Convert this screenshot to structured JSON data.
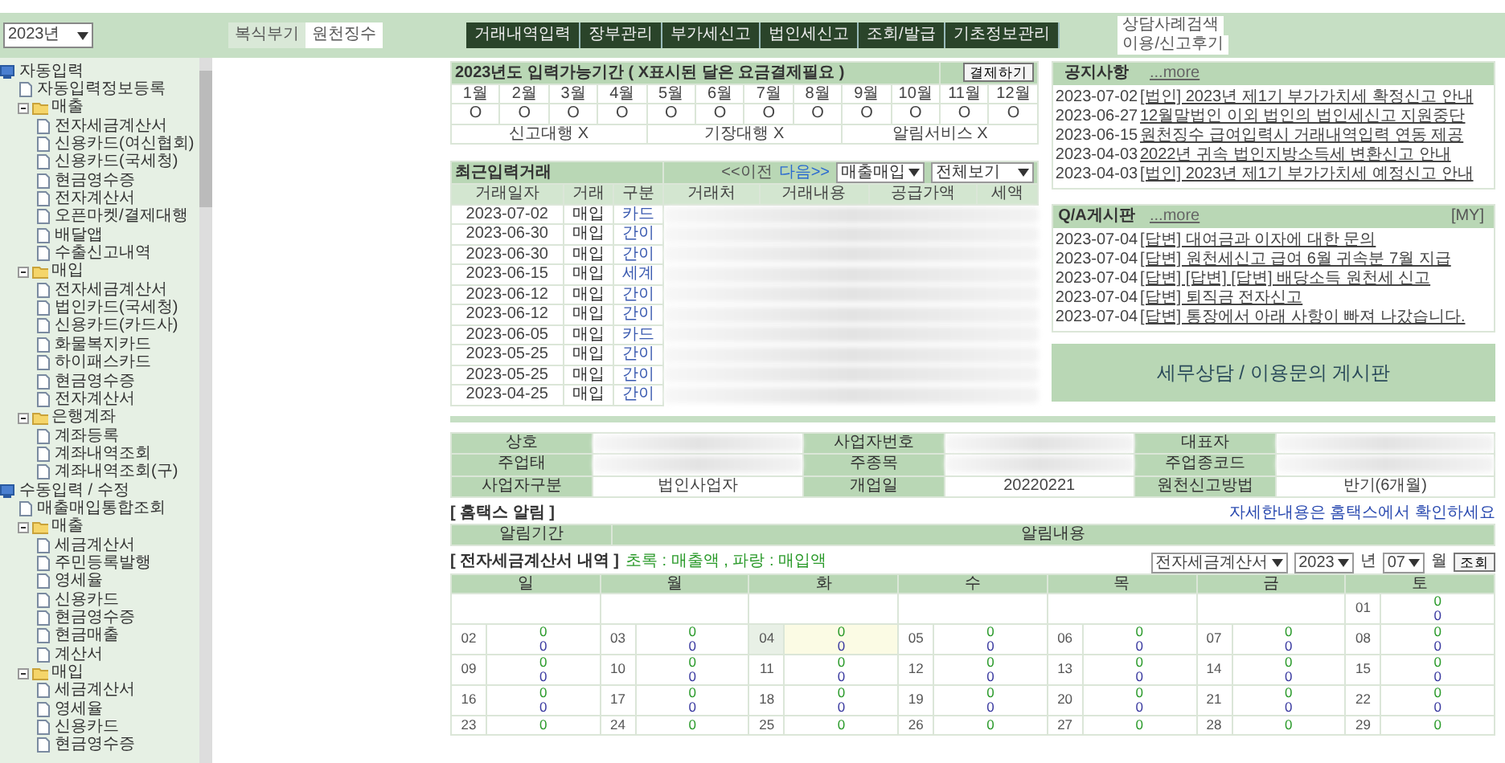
{
  "header": {
    "year_select": "2023년",
    "mode_buttons": [
      {
        "label": "복식부기",
        "selected": false
      },
      {
        "label": "원천징수",
        "selected": true
      }
    ],
    "menu": [
      "거래내역입력",
      "장부관리",
      "부가세신고",
      "법인세신고",
      "조회/발급",
      "기초정보관리"
    ],
    "side_links": [
      "상담사례검색",
      "이용/신고후기"
    ]
  },
  "sidebar": {
    "items": [
      {
        "label": "자동입력",
        "kind": "section",
        "children": [
          {
            "label": "자동입력정보등록",
            "kind": "page"
          },
          {
            "label": "매출",
            "kind": "folder",
            "children": [
              {
                "label": "전자세금계산서",
                "kind": "page"
              },
              {
                "label": "신용카드(여신협회)",
                "kind": "page"
              },
              {
                "label": "신용카드(국세청)",
                "kind": "page"
              },
              {
                "label": "현금영수증",
                "kind": "page"
              },
              {
                "label": "전자계산서",
                "kind": "page"
              },
              {
                "label": "오픈마켓/결제대행",
                "kind": "page"
              },
              {
                "label": "배달앱",
                "kind": "page"
              },
              {
                "label": "수출신고내역",
                "kind": "page"
              }
            ]
          },
          {
            "label": "매입",
            "kind": "folder",
            "children": [
              {
                "label": "전자세금계산서",
                "kind": "page"
              },
              {
                "label": "법인카드(국세청)",
                "kind": "page"
              },
              {
                "label": "신용카드(카드사)",
                "kind": "page"
              },
              {
                "label": "화물복지카드",
                "kind": "page"
              },
              {
                "label": "하이패스카드",
                "kind": "page"
              },
              {
                "label": "현금영수증",
                "kind": "page"
              },
              {
                "label": "전자계산서",
                "kind": "page"
              }
            ]
          },
          {
            "label": "은행계좌",
            "kind": "folder",
            "children": [
              {
                "label": "계좌등록",
                "kind": "page"
              },
              {
                "label": "계좌내역조회",
                "kind": "page"
              },
              {
                "label": "계좌내역조회(구)",
                "kind": "page"
              }
            ]
          }
        ]
      },
      {
        "label": "수동입력 / 수정",
        "kind": "section",
        "children": [
          {
            "label": "매출매입통합조회",
            "kind": "page"
          },
          {
            "label": "매출",
            "kind": "folder",
            "children": [
              {
                "label": "세금계산서",
                "kind": "page"
              },
              {
                "label": "주민등록발행",
                "kind": "page"
              },
              {
                "label": "영세율",
                "kind": "page"
              },
              {
                "label": "신용카드",
                "kind": "page"
              },
              {
                "label": "현금영수증",
                "kind": "page"
              },
              {
                "label": "현금매출",
                "kind": "page"
              },
              {
                "label": "계산서",
                "kind": "page"
              }
            ]
          },
          {
            "label": "매입",
            "kind": "folder",
            "children": [
              {
                "label": "세금계산서",
                "kind": "page"
              },
              {
                "label": "영세율",
                "kind": "page"
              },
              {
                "label": "신용카드",
                "kind": "page"
              },
              {
                "label": "현금영수증",
                "kind": "page"
              }
            ]
          }
        ]
      }
    ]
  },
  "period": {
    "title": "2023년도 입력가능기간 ( X표시된 달은 요금결제필요 )",
    "button": "결제하기",
    "months": [
      {
        "label": "1월",
        "status": "O"
      },
      {
        "label": "2월",
        "status": "O"
      },
      {
        "label": "3월",
        "status": "O"
      },
      {
        "label": "4월",
        "status": "O"
      },
      {
        "label": "5월",
        "status": "O"
      },
      {
        "label": "6월",
        "status": "O"
      },
      {
        "label": "7월",
        "status": "O"
      },
      {
        "label": "8월",
        "status": "O"
      },
      {
        "label": "9월",
        "status": "O"
      },
      {
        "label": "10월",
        "status": "O"
      },
      {
        "label": "11월",
        "status": "O"
      },
      {
        "label": "12월",
        "status": "O"
      }
    ],
    "services": [
      "신고대행 X",
      "기장대행 X",
      "알림서비스 X"
    ]
  },
  "recent": {
    "title": "최근입력거래",
    "prev": "<<이전",
    "next": "다음>>",
    "filters": [
      "매출매입",
      "전체보기"
    ],
    "columns": [
      "거래일자",
      "거래",
      "구분",
      "거래처",
      "거래내용",
      "공급가액",
      "세액"
    ],
    "rows": [
      {
        "date": "2023-07-02",
        "type": "매입",
        "category": "카드"
      },
      {
        "date": "2023-06-30",
        "type": "매입",
        "category": "간이"
      },
      {
        "date": "2023-06-30",
        "type": "매입",
        "category": "간이"
      },
      {
        "date": "2023-06-15",
        "type": "매입",
        "category": "세계"
      },
      {
        "date": "2023-06-12",
        "type": "매입",
        "category": "간이"
      },
      {
        "date": "2023-06-12",
        "type": "매입",
        "category": "간이"
      },
      {
        "date": "2023-06-05",
        "type": "매입",
        "category": "카드"
      },
      {
        "date": "2023-05-25",
        "type": "매입",
        "category": "간이"
      },
      {
        "date": "2023-05-25",
        "type": "매입",
        "category": "간이"
      },
      {
        "date": "2023-04-25",
        "type": "매입",
        "category": "간이"
      }
    ]
  },
  "notices": {
    "title": "공지사항",
    "more": "...more",
    "items": [
      {
        "date": "2023-07-02",
        "text": "[법인] 2023년 제1기 부가가치세 확정신고 안내"
      },
      {
        "date": "2023-06-27",
        "text": "12월말법인 이외 법인의 법인세신고 지원중단"
      },
      {
        "date": "2023-06-15",
        "text": "원천징수 급여입력시 거래내역입력 연동 제공"
      },
      {
        "date": "2023-04-03",
        "text": "2022년 귀속 법인지방소득세 변환신고 안내"
      },
      {
        "date": "2023-04-03",
        "text": "[법인] 2023년 제1기 부가가치세 예정신고 안내"
      }
    ]
  },
  "qa": {
    "title": "Q/A게시판",
    "more": "...more",
    "my": "[MY]",
    "items": [
      {
        "date": "2023-07-04",
        "text": "[답변] 대여금과 이자에 대한 문의"
      },
      {
        "date": "2023-07-04",
        "text": "[답변] 원천세신고 급여 6월 귀속분 7월 지급"
      },
      {
        "date": "2023-07-04",
        "text": "[답변] [답변] [답변] 배당소득 원천세 신고"
      },
      {
        "date": "2023-07-04",
        "text": "[답변] 퇴직금 전자신고"
      },
      {
        "date": "2023-07-04",
        "text": "[답변] 통장에서 아래 사항이 빠져 나갔습니다."
      }
    ]
  },
  "board_button": "세무상담 / 이용문의 게시판",
  "company": {
    "rows": [
      {
        "fields": [
          {
            "label": "상호"
          },
          {
            "label": "사업자번호"
          },
          {
            "label": "대표자"
          }
        ]
      },
      {
        "fields": [
          {
            "label": "주업태"
          },
          {
            "label": "주종목"
          },
          {
            "label": "주업종코드"
          }
        ]
      },
      {
        "fields": [
          {
            "label": "사업자구분",
            "value": "법인사업자"
          },
          {
            "label": "개업일",
            "value": "20220221"
          },
          {
            "label": "원천신고방법",
            "value": "반기(6개월)"
          }
        ]
      }
    ]
  },
  "hometax": {
    "title": "[ 홈택스 알림 ]",
    "link": "자세한내용은 홈택스에서 확인하세요",
    "columns": [
      "알림기간",
      "알림내용"
    ]
  },
  "calendar": {
    "title": "[ 전자세금계산서 내역 ]",
    "legend": "초록 : 매출액 , 파랑 : 매입액",
    "doc_select": "전자세금계산서",
    "year_select": "2023",
    "year_label": "년",
    "month_select": "07",
    "month_label": "월",
    "button": "조회",
    "weekdays": [
      "일",
      "월",
      "화",
      "수",
      "목",
      "금",
      "토"
    ],
    "weeks": [
      [
        {
          "kind": "blank"
        },
        {
          "kind": "blank"
        },
        {
          "kind": "blank"
        },
        {
          "kind": "blank"
        },
        {
          "kind": "blank"
        },
        {
          "kind": "blank"
        },
        {
          "kind": "day",
          "day": "01",
          "sales": "0",
          "purchase": "0",
          "today": false
        }
      ],
      [
        {
          "kind": "day",
          "day": "02",
          "sales": "0",
          "purchase": "0",
          "today": false
        },
        {
          "kind": "day",
          "day": "03",
          "sales": "0",
          "purchase": "0",
          "today": false
        },
        {
          "kind": "day",
          "day": "04",
          "sales": "0",
          "purchase": "0",
          "today": true
        },
        {
          "kind": "day",
          "day": "05",
          "sales": "0",
          "purchase": "0",
          "today": false
        },
        {
          "kind": "day",
          "day": "06",
          "sales": "0",
          "purchase": "0",
          "today": false
        },
        {
          "kind": "day",
          "day": "07",
          "sales": "0",
          "purchase": "0",
          "today": false
        },
        {
          "kind": "day",
          "day": "08",
          "sales": "0",
          "purchase": "0",
          "today": false
        }
      ],
      [
        {
          "kind": "day",
          "day": "09",
          "sales": "0",
          "purchase": "0",
          "today": false
        },
        {
          "kind": "day",
          "day": "10",
          "sales": "0",
          "purchase": "0",
          "today": false
        },
        {
          "kind": "day",
          "day": "11",
          "sales": "0",
          "purchase": "0",
          "today": false
        },
        {
          "kind": "day",
          "day": "12",
          "sales": "0",
          "purchase": "0",
          "today": false
        },
        {
          "kind": "day",
          "day": "13",
          "sales": "0",
          "purchase": "0",
          "today": false
        },
        {
          "kind": "day",
          "day": "14",
          "sales": "0",
          "purchase": "0",
          "today": false
        },
        {
          "kind": "day",
          "day": "15",
          "sales": "0",
          "purchase": "0",
          "today": false
        }
      ],
      [
        {
          "kind": "day",
          "day": "16",
          "sales": "0",
          "purchase": "0",
          "today": false
        },
        {
          "kind": "day",
          "day": "17",
          "sales": "0",
          "purchase": "0",
          "today": false
        },
        {
          "kind": "day",
          "day": "18",
          "sales": "0",
          "purchase": "0",
          "today": false
        },
        {
          "kind": "day",
          "day": "19",
          "sales": "0",
          "purchase": "0",
          "today": false
        },
        {
          "kind": "day",
          "day": "20",
          "sales": "0",
          "purchase": "0",
          "today": false
        },
        {
          "kind": "day",
          "day": "21",
          "sales": "0",
          "purchase": "0",
          "today": false
        },
        {
          "kind": "day",
          "day": "22",
          "sales": "0",
          "purchase": "0",
          "today": false
        }
      ],
      [
        {
          "kind": "day",
          "day": "23",
          "sales": "0",
          "today": false
        },
        {
          "kind": "day",
          "day": "24",
          "sales": "0",
          "today": false
        },
        {
          "kind": "day",
          "day": "25",
          "sales": "0",
          "today": false
        },
        {
          "kind": "day",
          "day": "26",
          "sales": "0",
          "today": false
        },
        {
          "kind": "day",
          "day": "27",
          "sales": "0",
          "today": false
        },
        {
          "kind": "day",
          "day": "28",
          "sales": "0",
          "today": false
        },
        {
          "kind": "day",
          "day": "29",
          "sales": "0",
          "today": false
        }
      ]
    ]
  }
}
